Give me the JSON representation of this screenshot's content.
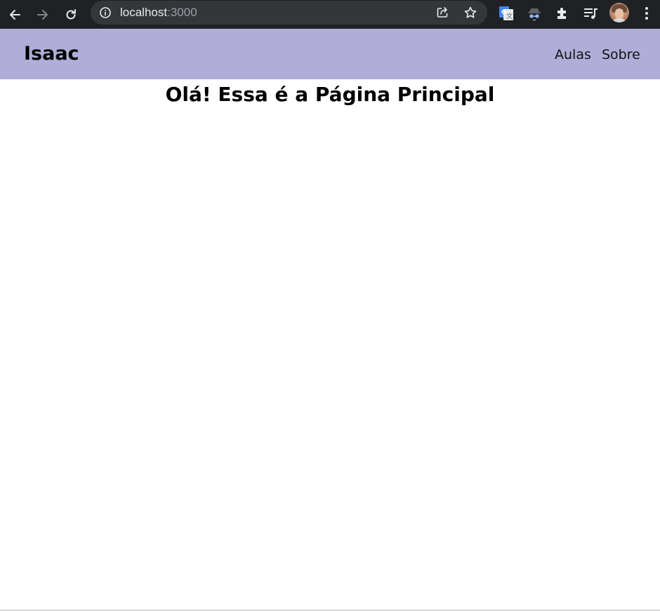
{
  "browser": {
    "url_host": "localhost",
    "url_port": ":3000"
  },
  "site": {
    "brand": "Isaac",
    "nav_links": [
      {
        "label": "Aulas"
      },
      {
        "label": "Sobre"
      }
    ],
    "heading": "Olá! Essa é a Página Principal"
  },
  "colors": {
    "navbar_background": "#b0aed8",
    "browser_chrome": "#202124",
    "omnibox_background": "#35363a"
  }
}
